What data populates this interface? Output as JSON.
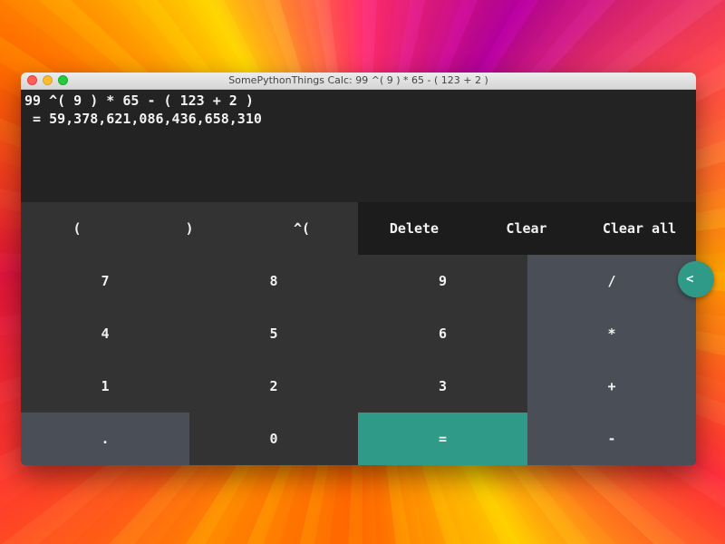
{
  "window": {
    "title": "SomePythonThings Calc:  99 ^( 9 ) * 65 - ( 123 + 2 )"
  },
  "display": {
    "expression": "99 ^( 9 ) * 65 - ( 123 + 2 )",
    "result": " = 59,378,621,086,436,658,310"
  },
  "buttons": {
    "open_paren": "(",
    "close_paren": ")",
    "power": "^(",
    "delete": "Delete",
    "clear": "Clear",
    "clear_all": "Clear all",
    "seven": "7",
    "eight": "8",
    "nine": "9",
    "divide": "/",
    "four": "4",
    "five": "5",
    "six": "6",
    "multiply": "*",
    "one": "1",
    "two": "2",
    "three": "3",
    "plus": "+",
    "dot": ".",
    "zero": "0",
    "equals": "=",
    "minus": "-"
  },
  "side_tab": {
    "label": "<"
  },
  "colors": {
    "background": "#232323",
    "key_dark": "#333333",
    "key_darker": "#1c1c1c",
    "key_gray": "#4a4f57",
    "accent": "#2f9a87"
  }
}
